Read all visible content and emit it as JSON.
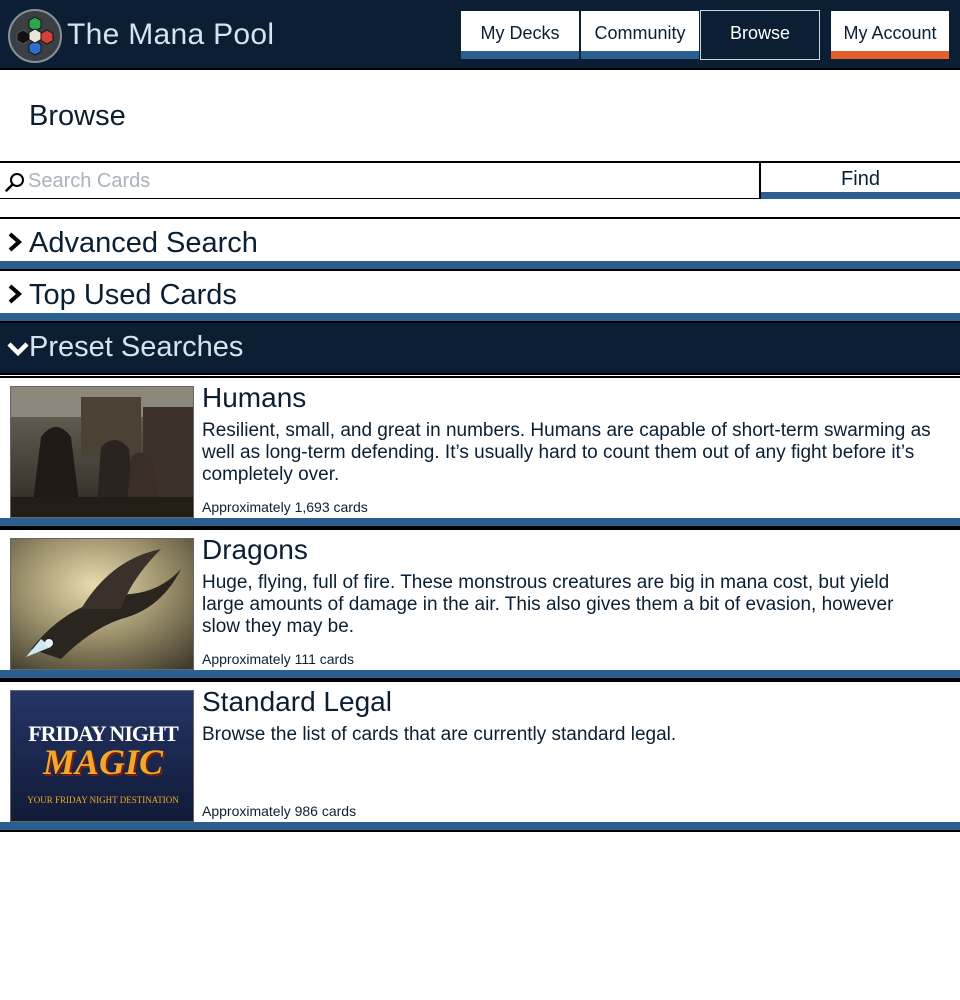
{
  "header": {
    "app_title": "The Mana Pool",
    "logo_icon": "mana-hexagon-logo-icon",
    "nav": [
      {
        "label": "My Decks"
      },
      {
        "label": "Community"
      },
      {
        "label": "Browse",
        "active": true
      },
      {
        "label": "My Account"
      }
    ]
  },
  "page": {
    "title": "Browse"
  },
  "search": {
    "placeholder": "Search Cards",
    "value": "",
    "button_label": "Find",
    "icon": "search-icon"
  },
  "accordion": {
    "advanced": {
      "label": "Advanced Search",
      "state": "collapsed"
    },
    "top_used": {
      "label": "Top Used Cards",
      "state": "collapsed"
    },
    "presets": {
      "label": "Preset Searches",
      "state": "expanded"
    }
  },
  "presets": [
    {
      "name": "Humans",
      "description": "Resilient, small, and great in numbers. Humans are capable of short-term swarming as well as long-term defending. It’s usually hard to count them out of any fight before it’s completely over.",
      "count": "Approximately 1,693 cards"
    },
    {
      "name": "Dragons",
      "description": "Huge, flying, full of fire. These monstrous creatures are big in mana cost, but yield large amounts of damage in the air. This also gives them a bit of evasion, however slow they may be.",
      "count": "Approximately 111 cards"
    },
    {
      "name": "Standard Legal",
      "description": "Browse the list of cards that are currently standard legal.",
      "count": "Approximately 986 cards",
      "image_text": {
        "line1": "FRIDAY NIGHT",
        "line2": "MAGIC",
        "line3": "YOUR FRIDAY NIGHT DESTINATION"
      }
    }
  ],
  "colors": {
    "navy": "#0b1e33",
    "accent_blue": "#2b5f90",
    "accent_orange": "#e4602b",
    "light_text": "#d7e3ef",
    "placeholder": "#a9b2bc"
  }
}
